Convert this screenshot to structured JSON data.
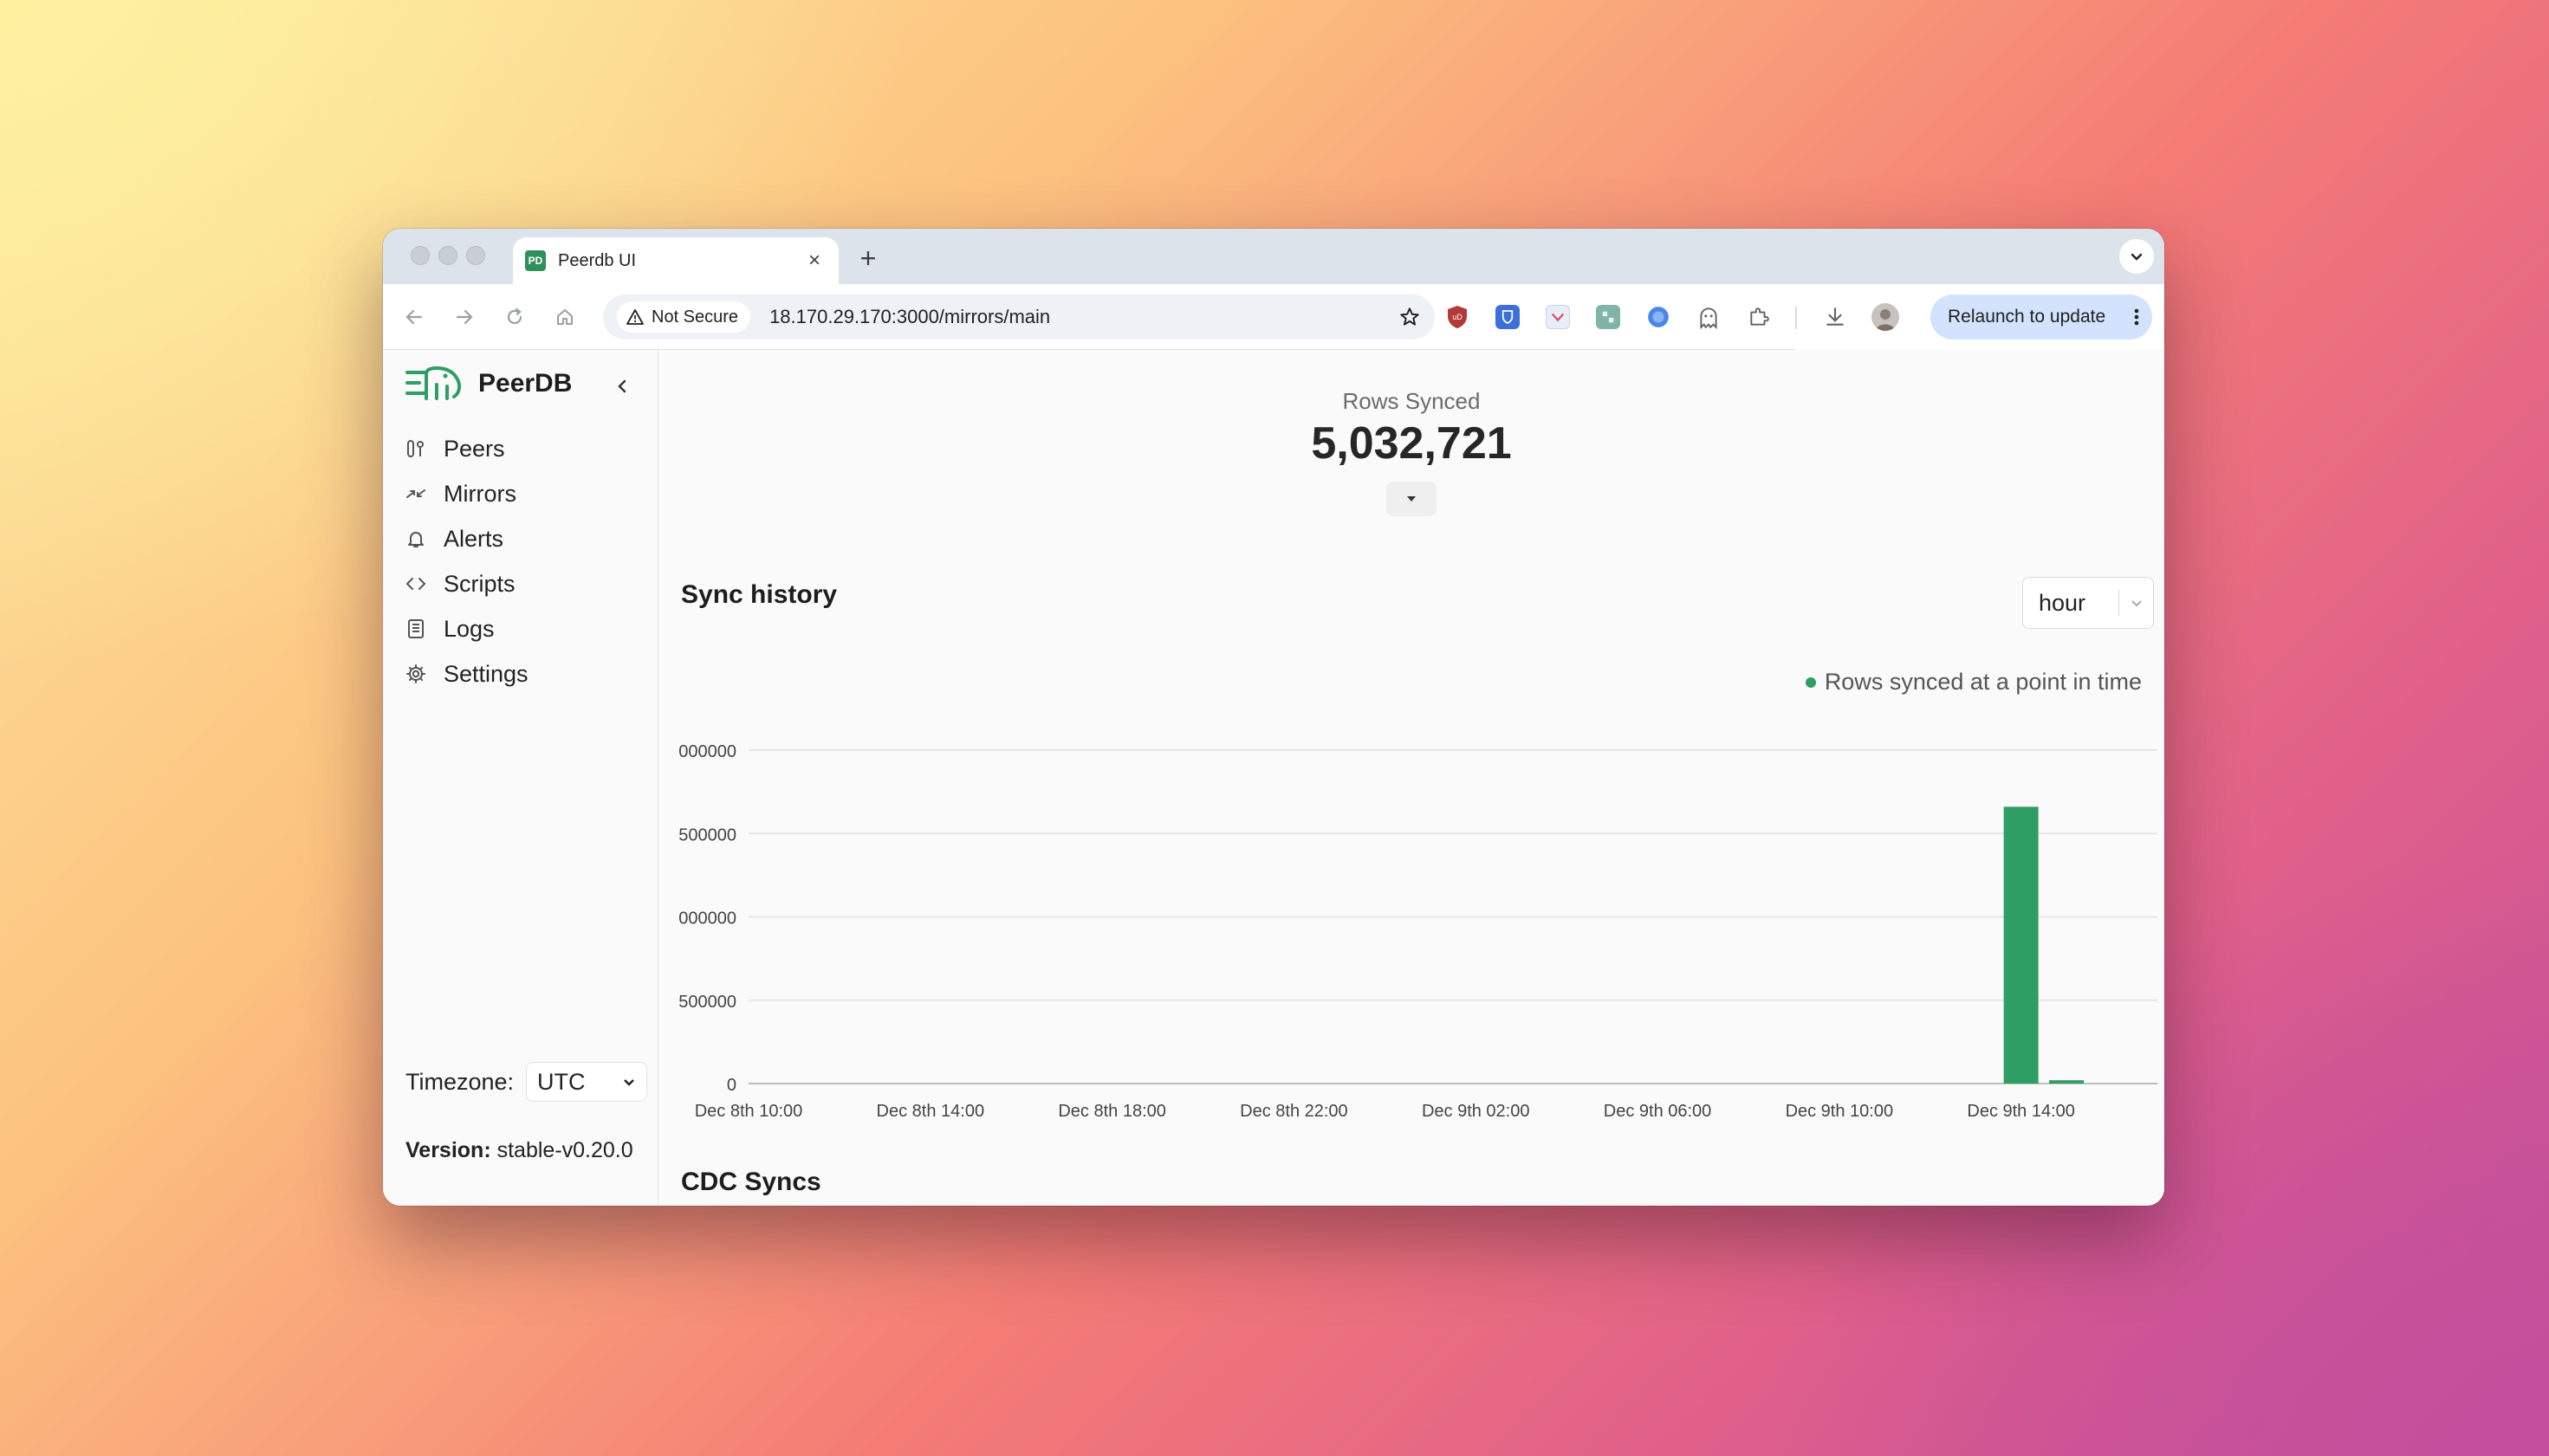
{
  "browser": {
    "tab_title": "Peerdb UI",
    "tab_icon": "peerdb-favicon",
    "favicon_text": "PD",
    "new_tab": "+",
    "security_label": "Not Secure",
    "url": "18.170.29.170:3000/mirrors/main",
    "relaunch_label": "Relaunch to update",
    "extensions": [
      "ublock-icon",
      "bitwarden-icon",
      "extension-icon",
      "extension-icon",
      "extension-icon",
      "ghost-icon",
      "puzzle-icon"
    ]
  },
  "sidebar": {
    "brand": "PeerDB",
    "items": [
      {
        "label": "Peers",
        "icon": "peers-icon"
      },
      {
        "label": "Mirrors",
        "icon": "mirrors-icon"
      },
      {
        "label": "Alerts",
        "icon": "bell-icon"
      },
      {
        "label": "Scripts",
        "icon": "code-icon"
      },
      {
        "label": "Logs",
        "icon": "logs-icon"
      },
      {
        "label": "Settings",
        "icon": "gear-icon"
      }
    ],
    "timezone_label": "Timezone:",
    "timezone_value": "UTC",
    "version_label": "Version:",
    "version_value": "stable-v0.20.0"
  },
  "main": {
    "stat_label": "Rows Synced",
    "stat_value": "5,032,721",
    "sync_history_title": "Sync history",
    "aggregate_value": "hour",
    "cdc_title": "CDC Syncs"
  },
  "colors": {
    "accent": "#2e9e64"
  },
  "chart_data": {
    "type": "bar",
    "legend": "Rows synced at a point in time",
    "legend_position": "top-right",
    "grid": true,
    "ylim": [
      0,
      2000000
    ],
    "y_ticks": [
      0,
      500000,
      1000000,
      1500000,
      2000000
    ],
    "y_tick_labels": [
      "0",
      "500000",
      "000000",
      "500000",
      "000000"
    ],
    "x_tick_labels": [
      "Dec 8th 10:00",
      "Dec 8th 14:00",
      "Dec 8th 18:00",
      "Dec 8th 22:00",
      "Dec 9th 02:00",
      "Dec 9th 06:00",
      "Dec 9th 10:00",
      "Dec 9th 14:00"
    ],
    "x_tick_hours": [
      10,
      14,
      18,
      22,
      26,
      30,
      34,
      38
    ],
    "x_range_hours": [
      10,
      41
    ],
    "bars": [
      {
        "label": "Dec 9th 14:00",
        "hour": 38,
        "value": 1660000
      },
      {
        "label": "Dec 9th 15:00",
        "hour": 39,
        "value": 20000
      }
    ]
  }
}
